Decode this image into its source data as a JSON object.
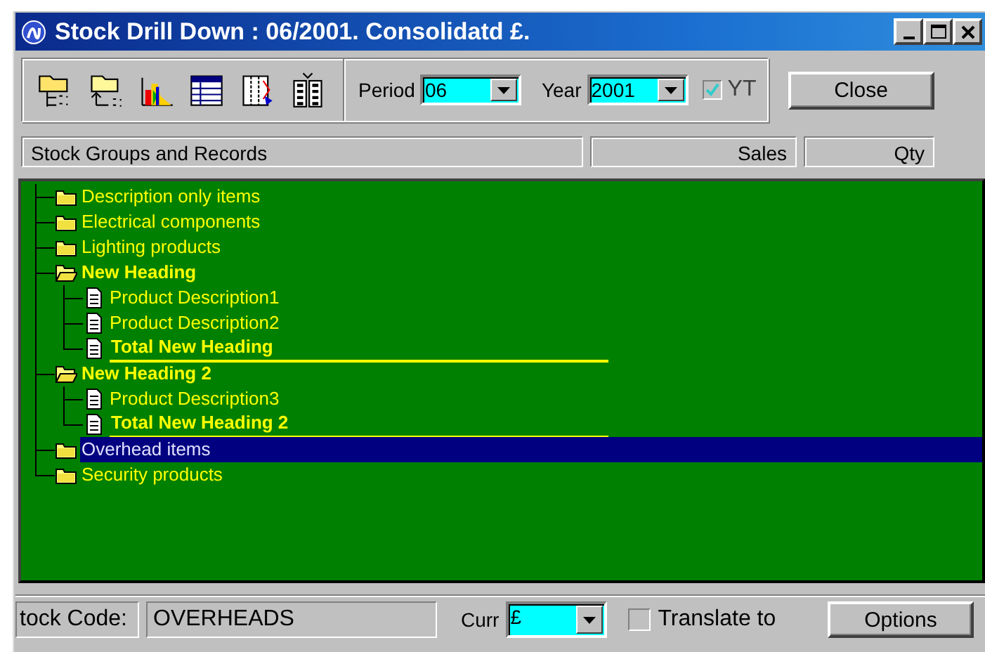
{
  "window": {
    "title": "Stock Drill Down : 06/2001. Consolidatd £."
  },
  "toolbar": {
    "period": {
      "label": "Period",
      "value": "06"
    },
    "year": {
      "label": "Year",
      "value": "2001"
    },
    "ytd": {
      "label": "YT",
      "checked": true,
      "disabled": true
    },
    "close_button": "Close"
  },
  "columns": [
    "Stock Groups and Records",
    "Sales",
    "Qty"
  ],
  "tree": {
    "items": [
      {
        "label": "Description only items",
        "kind": "group",
        "selected": false
      },
      {
        "label": "Electrical components",
        "kind": "group",
        "selected": false
      },
      {
        "label": "Lighting products",
        "kind": "group",
        "selected": false
      },
      {
        "label": "New Heading",
        "kind": "heading",
        "expanded": true,
        "selected": false,
        "children": [
          {
            "label": "Product Description1",
            "kind": "item",
            "selected": false
          },
          {
            "label": "Product Description2",
            "kind": "item",
            "selected": false
          },
          {
            "label": "Total New Heading",
            "kind": "total",
            "selected": false
          }
        ]
      },
      {
        "label": "New Heading 2",
        "kind": "heading",
        "expanded": true,
        "selected": false,
        "children": [
          {
            "label": "Product Description3",
            "kind": "item",
            "selected": false
          },
          {
            "label": "Total New Heading 2",
            "kind": "total",
            "selected": false
          }
        ]
      },
      {
        "label": "Overhead items",
        "kind": "group",
        "selected": true
      },
      {
        "label": "Security products",
        "kind": "group",
        "selected": false
      }
    ]
  },
  "footer": {
    "code_label": "tock Code:",
    "code_value": "OVERHEADS",
    "currency": {
      "label": "Curr",
      "value": "£"
    },
    "translate": {
      "label": "Translate to",
      "checked": false
    },
    "options_button": "Options"
  }
}
